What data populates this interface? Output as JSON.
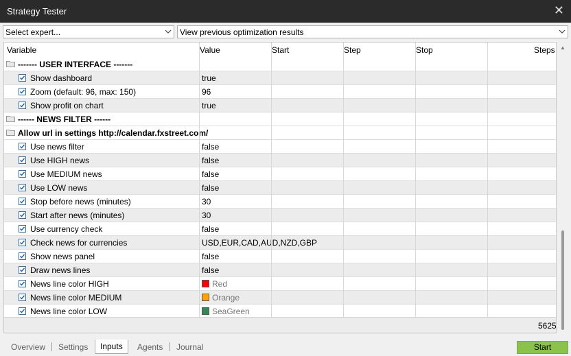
{
  "window": {
    "title": "Strategy Tester"
  },
  "toolbar": {
    "expert_select": "Select expert...",
    "optimization_select": "View previous optimization results"
  },
  "columns": {
    "variable": "Variable",
    "value": "Value",
    "start": "Start",
    "step": "Step",
    "stop": "Stop",
    "steps": "Steps"
  },
  "rows": [
    {
      "type": "group",
      "label": "------- USER INTERFACE -------"
    },
    {
      "type": "param",
      "variable": "Show dashboard",
      "value": "true"
    },
    {
      "type": "param",
      "variable": "Zoom (default: 96, max: 150)",
      "value": "96"
    },
    {
      "type": "param",
      "variable": "Show profit on chart",
      "value": "true"
    },
    {
      "type": "group",
      "label": "------ NEWS FILTER ------"
    },
    {
      "type": "group",
      "label": "Allow url in settings http://calendar.fxstreet.com/"
    },
    {
      "type": "param",
      "variable": "Use news filter",
      "value": "false"
    },
    {
      "type": "param",
      "variable": "Use HIGH news",
      "value": "false"
    },
    {
      "type": "param",
      "variable": "Use MEDIUM news",
      "value": "false"
    },
    {
      "type": "param",
      "variable": "Use LOW news",
      "value": "false"
    },
    {
      "type": "param",
      "variable": "Stop before news (minutes)",
      "value": "30"
    },
    {
      "type": "param",
      "variable": "Start after news (minutes)",
      "value": "30"
    },
    {
      "type": "param",
      "variable": "Use currency check",
      "value": "false"
    },
    {
      "type": "param",
      "variable": "Check news for currencies",
      "value": "USD,EUR,CAD,AUD,NZD,GBP"
    },
    {
      "type": "param",
      "variable": "Show news panel",
      "value": "false"
    },
    {
      "type": "param",
      "variable": "Draw news lines",
      "value": "false"
    },
    {
      "type": "param",
      "variable": "News line color HIGH",
      "value": "Red",
      "color": "#ff0000"
    },
    {
      "type": "param",
      "variable": "News line color MEDIUM",
      "value": "Orange",
      "color": "#ffa500"
    },
    {
      "type": "param",
      "variable": "News line color LOW",
      "value": "SeaGreen",
      "color": "#2e8b57"
    }
  ],
  "total_steps": "5625",
  "tabs": [
    {
      "label": "Overview"
    },
    {
      "label": "Settings"
    },
    {
      "label": "Inputs",
      "active": true
    },
    {
      "label": "Agents"
    },
    {
      "label": "Journal"
    }
  ],
  "start_button": "Start",
  "colors": {
    "start_button": "#8bc34a",
    "titlebar": "#2b2b2b"
  }
}
